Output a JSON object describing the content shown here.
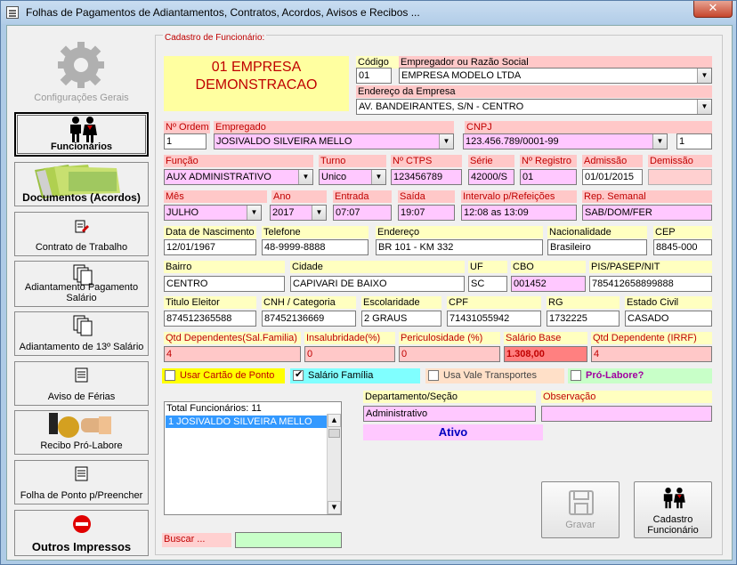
{
  "window": {
    "title": "Folhas de Pagamentos de Adiantamentos, Contratos, Acordos, Avisos e Recibos ...",
    "close": "✕"
  },
  "nav": {
    "configuracoes": "Configurações Gerais",
    "funcionarios": "Funcionários",
    "documentos": "Documentos (Acordos)",
    "contrato": "Contrato de Trabalho",
    "adiantamento_l1": "Adiantamento Pagamento",
    "adiantamento_l2": "Salário",
    "decimo": "Adiantamento de 13º Salário",
    "aviso": "Aviso de  Férias",
    "recibo": "Recibo Pró-Labore",
    "folha_ponto": "Folha de Ponto p/Preencher",
    "outros": "Outros Impressos"
  },
  "form": {
    "group_title": "Cadastro de Funcionário:",
    "empresa_l1": "01 EMPRESA",
    "empresa_l2": "DEMONSTRACAO",
    "codigo_label": "Código",
    "codigo": "01",
    "empregador_label": "Empregador ou Razão Social",
    "empregador": "EMPRESA MODELO LTDA",
    "endereco_empresa_label": "Endereço da Empresa",
    "endereco_empresa": "AV. BANDEIRANTES, S/N - CENTRO",
    "ordem_label": "Nº Ordem",
    "ordem": "1",
    "empregado_label": "Empregado",
    "empregado": "JOSIVALDO SILVEIRA MELLO",
    "cnpj_label": "CNPJ",
    "cnpj": "123.456.789/0001-99",
    "cnpj_extra": "1",
    "funcao_label": "Função",
    "funcao": "AUX ADMINISTRATIVO",
    "turno_label": "Turno",
    "turno": "Unico",
    "ctps_label": "Nº CTPS",
    "ctps": "123456789",
    "serie_label": "Série",
    "serie": "42000/S",
    "registro_label": "Nº Registro",
    "registro": "01",
    "admissao_label": "Admissão",
    "admissao": "01/01/2015",
    "demissao_label": "Demissão",
    "demissao": "",
    "mes_label": "Mês",
    "mes": "JULHO",
    "ano_label": "Ano",
    "ano": "2017",
    "entrada_label": "Entrada",
    "entrada": "07:07",
    "saida_label": "Saída",
    "saida": "19:07",
    "intervalo_label": "Intervalo p/Refeições",
    "intervalo": "12:08 as 13:09",
    "rep_label": "Rep. Semanal",
    "rep": "SAB/DOM/FER",
    "nascimento_label": "Data de Nascimento",
    "nascimento": "12/01/1967",
    "telefone_label": "Telefone",
    "telefone": "48-9999-8888",
    "endereco_label": "Endereço",
    "endereco": "BR 101 - KM 332",
    "nacionalidade_label": "Nacionalidade",
    "nacionalidade": "Brasileiro",
    "cep_label": "CEP",
    "cep": "8845-000",
    "bairro_label": "Bairro",
    "bairro": "CENTRO",
    "cidade_label": "Cidade",
    "cidade": "CAPIVARI DE BAIXO",
    "uf_label": "UF",
    "uf": "SC",
    "cbo_label": "CBO",
    "cbo": "001452",
    "pis_label": "PIS/PASEP/NIT",
    "pis": "785412658899888",
    "titulo_label": "Titulo Eleitor",
    "titulo": "874512365588",
    "cnh_label": "CNH / Categoria",
    "cnh": "87452136669",
    "escolaridade_label": "Escolaridade",
    "escolaridade": "2 GRAUS",
    "cpf_label": "CPF",
    "cpf": "71431055942",
    "rg_label": "RG",
    "rg": "1732225",
    "estado_civil_label": "Estado Civil",
    "estado_civil": "CASADO",
    "dependentes_label": "Qtd Dependentes(Sal.Familia)",
    "dependentes": "4",
    "insalubridade_label": "Insalubridade(%)",
    "insalubridade": "0",
    "periculosidade_label": "Periculosidade (%)",
    "periculosidade": "0",
    "salario_label": "Salário Base",
    "salario": "1.308,00",
    "dep_irrf_label": "Qtd Dependente (IRRF)",
    "dep_irrf": "4",
    "cartao_ponto": "Usar Cartão de Ponto",
    "salario_familia": "Salário Família",
    "vale_transportes": "Usa Vale Transportes",
    "pro_labore": "Pró-Labore?",
    "total_funcionarios": "Total Funcionários: 11",
    "lista_item": "1  JOSIVALDO SILVEIRA MELLO",
    "departamento_label": "Departamento/Seção",
    "departamento": "Administrativo",
    "observacao_label": "Observação",
    "observacao": "",
    "status": "Ativo",
    "buscar_label": "Buscar ...",
    "buscar": "",
    "gravar": "Gravar",
    "cadastro_l1": "Cadastro",
    "cadastro_l2": "Funcionário"
  },
  "checks": {
    "cartao_ponto": false,
    "salario_familia": true,
    "vale_transportes": false,
    "pro_labore": false
  }
}
